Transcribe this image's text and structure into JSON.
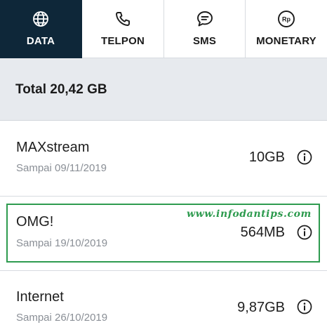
{
  "tabs": [
    {
      "label": "DATA",
      "icon": "globe-icon",
      "active": true
    },
    {
      "label": "TELPON",
      "icon": "phone-icon",
      "active": false
    },
    {
      "label": "SMS",
      "icon": "chat-bubble-icon",
      "active": false
    },
    {
      "label": "MONETARY",
      "icon": "rupiah-coin-icon",
      "active": false
    }
  ],
  "total": {
    "label": "Total 20,42 GB"
  },
  "packages": [
    {
      "name": "MAXstream",
      "expiry": "Sampai 09/11/2019",
      "amount": "10GB"
    },
    {
      "name": "OMG!",
      "expiry": "Sampai 19/10/2019",
      "amount": "564MB"
    },
    {
      "name": "Internet",
      "expiry": "Sampai 26/10/2019",
      "amount": "9,87GB"
    }
  ],
  "watermark": {
    "text": "www.infodantips.com"
  },
  "colors": {
    "active_tab_bg": "#0e2739",
    "total_bar_bg": "#e7eaee",
    "highlight_border": "#2e9b4f",
    "muted_text": "#8a8f96"
  }
}
